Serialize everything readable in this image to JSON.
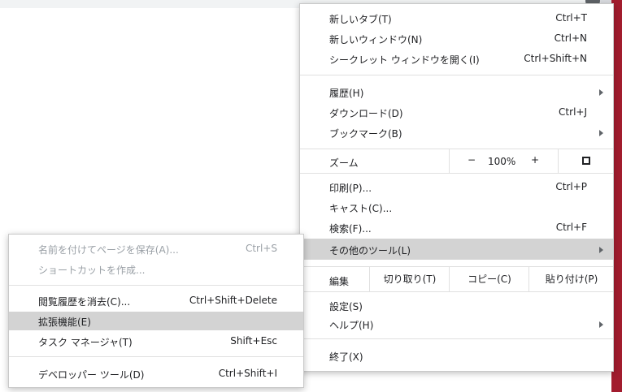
{
  "main_menu": {
    "new_tab": {
      "label": "新しいタブ(T)",
      "shortcut": "Ctrl+T"
    },
    "new_window": {
      "label": "新しいウィンドウ(N)",
      "shortcut": "Ctrl+N"
    },
    "incognito": {
      "label": "シークレット ウィンドウを開く(I)",
      "shortcut": "Ctrl+Shift+N"
    },
    "history": {
      "label": "履歴(H)"
    },
    "downloads": {
      "label": "ダウンロード(D)",
      "shortcut": "Ctrl+J"
    },
    "bookmarks": {
      "label": "ブックマーク(B)"
    },
    "zoom": {
      "label": "ズーム",
      "minus": "−",
      "value": "100%",
      "plus": "+"
    },
    "print": {
      "label": "印刷(P)...",
      "shortcut": "Ctrl+P"
    },
    "cast": {
      "label": "キャスト(C)..."
    },
    "find": {
      "label": "検索(F)...",
      "shortcut": "Ctrl+F"
    },
    "more_tools": {
      "label": "その他のツール(L)"
    },
    "edit": {
      "label": "編集",
      "cut": "切り取り(T)",
      "copy": "コピー(C)",
      "paste": "貼り付け(P)"
    },
    "settings": {
      "label": "設定(S)"
    },
    "help": {
      "label": "ヘルプ(H)"
    },
    "exit": {
      "label": "終了(X)"
    }
  },
  "submenu": {
    "save_page": {
      "label": "名前を付けてページを保存(A)...",
      "shortcut": "Ctrl+S"
    },
    "create_shortcut": {
      "label": "ショートカットを作成..."
    },
    "clear_data": {
      "label": "閲覧履歴を消去(C)...",
      "shortcut": "Ctrl+Shift+Delete"
    },
    "extensions": {
      "label": "拡張機能(E)"
    },
    "task_manager": {
      "label": "タスク マネージャ(T)",
      "shortcut": "Shift+Esc"
    },
    "dev_tools": {
      "label": "デベロッパー ツール(D)",
      "shortcut": "Ctrl+Shift+I"
    }
  }
}
